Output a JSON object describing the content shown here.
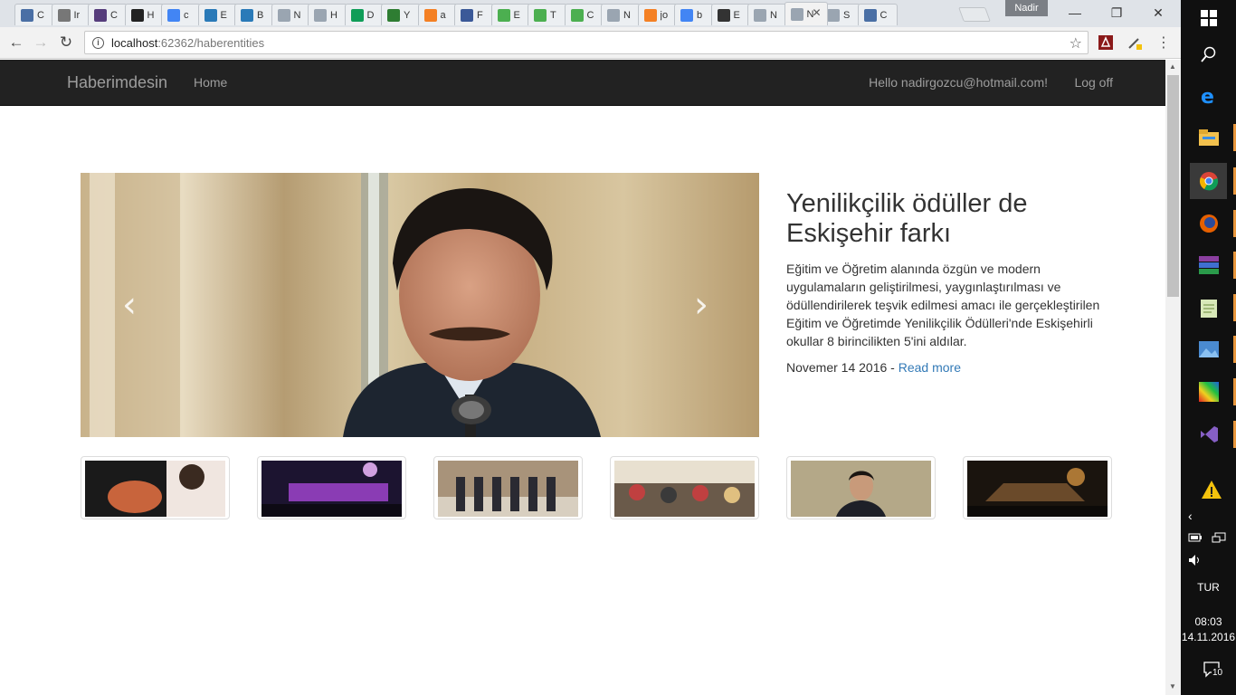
{
  "browser": {
    "tabs": [
      {
        "label": "C",
        "icon": "shield-favicon",
        "color": "#4a6fa5"
      },
      {
        "label": "Ir",
        "icon": "audio-favicon",
        "color": "#777777"
      },
      {
        "label": "C",
        "icon": "bootstrap-favicon",
        "color": "#563d7c"
      },
      {
        "label": "H",
        "icon": "bbc-favicon",
        "color": "#222222"
      },
      {
        "label": "c",
        "icon": "google-favicon",
        "color": "#4285f4"
      },
      {
        "label": "E",
        "icon": "bootstrap-favicon",
        "color": "#2a7ab8"
      },
      {
        "label": "B",
        "icon": "bootstrap-favicon",
        "color": "#2a7ab8"
      },
      {
        "label": "N",
        "icon": "page-favicon",
        "color": "#9aa5b1"
      },
      {
        "label": "H",
        "icon": "page-favicon",
        "color": "#9aa5b1"
      },
      {
        "label": "D",
        "icon": "drive-favicon",
        "color": "#0f9d58"
      },
      {
        "label": "Y",
        "icon": "rt-favicon",
        "color": "#2e7d32"
      },
      {
        "label": "a",
        "icon": "stackoverflow-favicon",
        "color": "#f48024"
      },
      {
        "label": "F",
        "icon": "facebook-favicon",
        "color": "#3b5998"
      },
      {
        "label": "E",
        "icon": "w3schools-favicon",
        "color": "#4caf50"
      },
      {
        "label": "T",
        "icon": "w3schools-favicon",
        "color": "#4caf50"
      },
      {
        "label": "C",
        "icon": "w3schools-favicon",
        "color": "#4caf50"
      },
      {
        "label": "N",
        "icon": "page-favicon",
        "color": "#9aa5b1"
      },
      {
        "label": "jo",
        "icon": "stackoverflow-favicon",
        "color": "#f48024"
      },
      {
        "label": "b",
        "icon": "google-favicon",
        "color": "#4285f4"
      },
      {
        "label": "E",
        "icon": "bootstrap-favicon",
        "color": "#333333"
      },
      {
        "label": "N",
        "icon": "page-favicon",
        "color": "#9aa5b1"
      },
      {
        "label": "N",
        "icon": "page-favicon",
        "color": "#9aa5b1",
        "active": true
      },
      {
        "label": "S",
        "icon": "page-favicon",
        "color": "#9aa5b1"
      },
      {
        "label": "C",
        "icon": "shield-favicon",
        "color": "#4a6fa5"
      }
    ],
    "profile_name": "Nadir",
    "url_host": "localhost",
    "url_path": ":62362/haberentities",
    "window_controls": {
      "minimize": "—",
      "restore": "❐",
      "close": "✕"
    }
  },
  "site": {
    "brand": "Haberimdesin",
    "nav_home": "Home",
    "greeting": "Hello nadirgozcu@hotmail.com!",
    "logoff": "Log off"
  },
  "featured": {
    "title": "Yenilikçilik ödüller de Eskişehir farkı",
    "summary": "Eğitim ve Öğretim alanında özgün ve modern uygulamaların geliştirilmesi, yaygınlaştırılması ve ödüllendirilerek teşvik edilmesi amacı ile gerçekleştirilen Eğitim ve Öğretimde Yenilikçilik Ödülleri'nde Eskişehirli okullar 8 birincilikten 5'ini aldılar.",
    "date": "Novemer 14 2016",
    "separator": " - ",
    "read_more": "Read more",
    "prev_glyph": "‹",
    "next_glyph": "›"
  },
  "thumbnails": [
    {
      "name": "thumb-medical",
      "palette": [
        "#1a1a1a",
        "#c8643c",
        "#f0e6e0"
      ]
    },
    {
      "name": "thumb-stage",
      "palette": [
        "#1c1430",
        "#8a3cb4",
        "#d0a0e0"
      ]
    },
    {
      "name": "thumb-group",
      "palette": [
        "#a8937a",
        "#2a2a32",
        "#d8cfc0"
      ]
    },
    {
      "name": "thumb-meeting",
      "palette": [
        "#6a5a4a",
        "#c04040",
        "#e8e0d0"
      ]
    },
    {
      "name": "thumb-portrait",
      "palette": [
        "#b4a888",
        "#1e2028",
        "#c89a7a"
      ]
    },
    {
      "name": "thumb-car-fire",
      "palette": [
        "#1a140e",
        "#6a4a2a",
        "#d09040"
      ]
    }
  ],
  "taskbar": {
    "keyboard_lang": "TUR",
    "time": "08:03",
    "date": "14.11.2016",
    "notifications": "10"
  }
}
